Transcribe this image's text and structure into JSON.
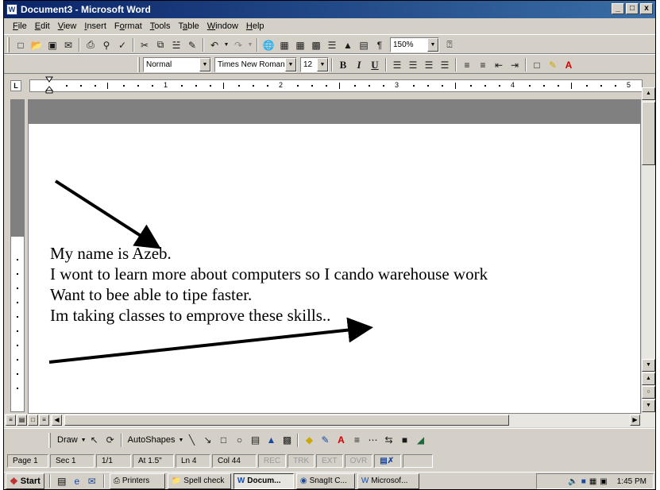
{
  "window": {
    "title": "Document3 - Microsoft Word",
    "app_icon": "W",
    "controls": [
      "_",
      "□",
      "x"
    ]
  },
  "menu": [
    {
      "ul": "F",
      "rest": "ile"
    },
    {
      "ul": "E",
      "rest": "dit"
    },
    {
      "ul": "V",
      "rest": "iew"
    },
    {
      "ul": "I",
      "rest": "nsert"
    },
    {
      "pre": "F",
      "ul": "o",
      "rest": "rmat"
    },
    {
      "ul": "T",
      "rest": "ools"
    },
    {
      "pre": "T",
      "ul": "a",
      "rest": "ble"
    },
    {
      "ul": "W",
      "rest": "indow"
    },
    {
      "ul": "H",
      "rest": "elp"
    }
  ],
  "standard_toolbar": {
    "zoom": "150%"
  },
  "formatting_toolbar": {
    "style": "Normal",
    "font": "Times New Roman",
    "size": "12",
    "bold": "B",
    "italic": "I",
    "underline": "U"
  },
  "ruler": {
    "numbers": [
      "1",
      "2",
      "3",
      "4",
      "5"
    ]
  },
  "document": {
    "lines": [
      "My name is Azeb.",
      "I wont to learn more about computers so I cando warehouse work",
      "Want to bee able to tipe faster.",
      "Im taking classes to emprove these skills.."
    ]
  },
  "drawing_toolbar": {
    "draw": "Draw",
    "autoshapes": "AutoShapes"
  },
  "status_bar": {
    "page": "Page 1",
    "sec": "Sec 1",
    "pages": "1/1",
    "at": "At 1.5\"",
    "ln": "Ln 4",
    "col": "Col 44",
    "rec": "REC",
    "trk": "TRK",
    "ext": "EXT",
    "ovr": "OVR"
  },
  "taskbar": {
    "start": "Start",
    "buttons": [
      "Printers",
      "Spell check",
      "Docum...",
      "SnagIt C...",
      "Microsof..."
    ],
    "clock": "1:45 PM"
  },
  "colors": {
    "title_start": "#0a246a",
    "title_end": "#3a6ea5",
    "spell_error": "#d00000",
    "face": "#d4d0c8"
  }
}
